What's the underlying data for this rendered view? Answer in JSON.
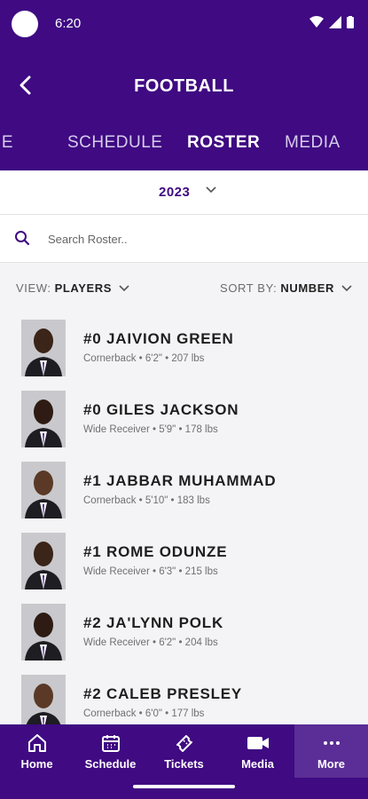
{
  "status": {
    "time": "6:20"
  },
  "header": {
    "title": "FOOTBALL"
  },
  "tabs": [
    {
      "label": "HOME",
      "active": false
    },
    {
      "label": "SCHEDULE",
      "active": false
    },
    {
      "label": "ROSTER",
      "active": true
    },
    {
      "label": "MEDIA",
      "active": false
    }
  ],
  "season": {
    "year": "2023"
  },
  "search": {
    "placeholder": "Search Roster..",
    "value": ""
  },
  "filters": {
    "view_label": "VIEW:",
    "view_value": "PLAYERS",
    "sort_label": "SORT BY:",
    "sort_value": "NUMBER"
  },
  "players": [
    {
      "name": "#0 JAIVION GREEN",
      "meta": "Cornerback • 6'2\" • 207 lbs"
    },
    {
      "name": "#0 GILES JACKSON",
      "meta": "Wide Receiver • 5'9\" • 178 lbs"
    },
    {
      "name": "#1 JABBAR MUHAMMAD",
      "meta": "Cornerback • 5'10\" • 183 lbs"
    },
    {
      "name": "#1 ROME ODUNZE",
      "meta": "Wide Receiver • 6'3\" • 215 lbs"
    },
    {
      "name": "#2 JA'LYNN POLK",
      "meta": "Wide Receiver • 6'2\" • 204 lbs"
    },
    {
      "name": "#2 CALEB PRESLEY",
      "meta": "Cornerback • 6'0\" • 177 lbs"
    }
  ],
  "nav": [
    {
      "label": "Home",
      "icon": "home-icon",
      "active": false
    },
    {
      "label": "Schedule",
      "icon": "calendar-icon",
      "active": false
    },
    {
      "label": "Tickets",
      "icon": "ticket-icon",
      "active": false
    },
    {
      "label": "Media",
      "icon": "video-icon",
      "active": false
    },
    {
      "label": "More",
      "icon": "more-icon",
      "active": true
    }
  ],
  "colors": {
    "brand": "#3f0a82",
    "brand_active": "#5b2d96",
    "background": "#f4f4f6"
  }
}
